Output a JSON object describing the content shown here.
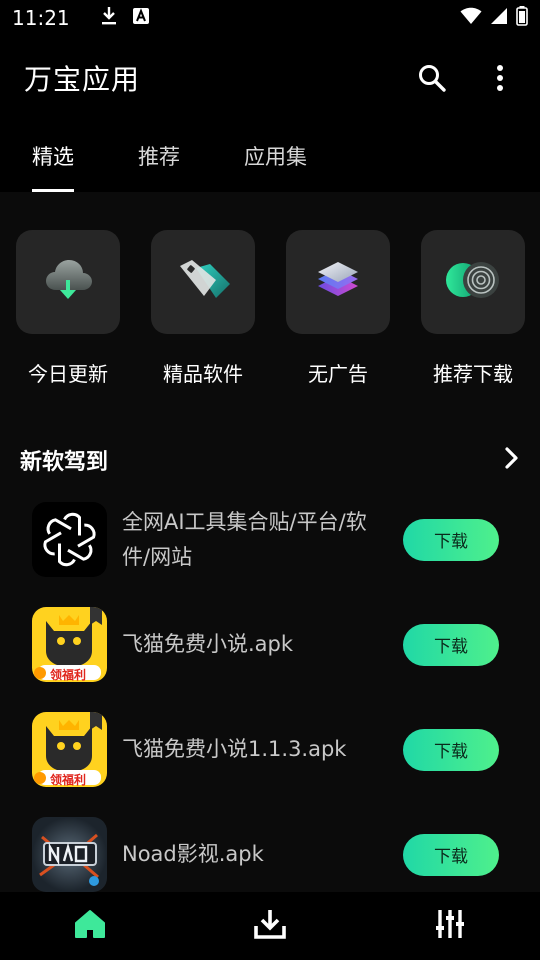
{
  "status_bar": {
    "time": "11:21",
    "icons": [
      "download-icon",
      "text-a-icon",
      "wifi-icon",
      "signal-icon",
      "battery-icon"
    ]
  },
  "app_bar": {
    "title": "万宝应用",
    "actions": [
      "search-icon",
      "more-vert-icon"
    ]
  },
  "tabs": [
    {
      "label": "精选",
      "active": true
    },
    {
      "label": "推荐",
      "active": false
    },
    {
      "label": "应用集",
      "active": false
    }
  ],
  "categories": [
    {
      "label": "今日更新",
      "icon": "cloud-download-icon"
    },
    {
      "label": "精品软件",
      "icon": "tag-icon"
    },
    {
      "label": "无广告",
      "icon": "layers-icon"
    },
    {
      "label": "推荐下载",
      "icon": "toggle-target-icon"
    }
  ],
  "section": {
    "title": "新软驾到",
    "more_icon": "chevron-right-icon"
  },
  "apps": [
    {
      "name": "全网AI工具集合贴/平台/软件/网站",
      "button": "下载",
      "icon": "openai-logo-icon"
    },
    {
      "name": "飞猫免费小说.apk",
      "button": "下载",
      "icon": "cat-novel-icon",
      "badge": "领福利"
    },
    {
      "name": "飞猫免费小说1.1.3.apk",
      "button": "下载",
      "icon": "cat-novel-icon",
      "badge": "领福利"
    },
    {
      "name": "Noad影视.apk",
      "button": "下载",
      "icon": "noad-video-icon"
    }
  ],
  "bottom_nav": [
    {
      "icon": "home-icon",
      "active": true
    },
    {
      "icon": "download-tray-icon",
      "active": false
    },
    {
      "icon": "equalizer-icon",
      "active": false
    }
  ],
  "colors": {
    "accent": "#3ee89a",
    "background": "#0b0b0b",
    "bar": "#000000",
    "tile": "#262626"
  }
}
